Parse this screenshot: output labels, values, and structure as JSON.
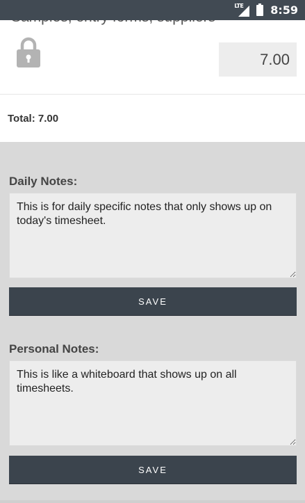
{
  "status_bar": {
    "network": "LTE",
    "time": "8:59",
    "icons": [
      "lte-signal-icon",
      "battery-icon"
    ]
  },
  "entry": {
    "title": "Samples, entry forms, suppliers",
    "amount": "7.00",
    "icon": "lock-icon"
  },
  "total": {
    "text": "Total: 7.00"
  },
  "daily_notes": {
    "label": "Daily Notes:",
    "value": "This is for daily specific notes that only shows up on today's timesheet.",
    "save_label": "SAVE"
  },
  "personal_notes": {
    "label": "Personal Notes:",
    "value": "This is like a whiteboard that shows up on all timesheets.",
    "save_label": "SAVE"
  },
  "colors": {
    "status_bar": "#414a53",
    "button": "#3b444d",
    "background": "#d9d9d9",
    "field": "#ededed"
  }
}
